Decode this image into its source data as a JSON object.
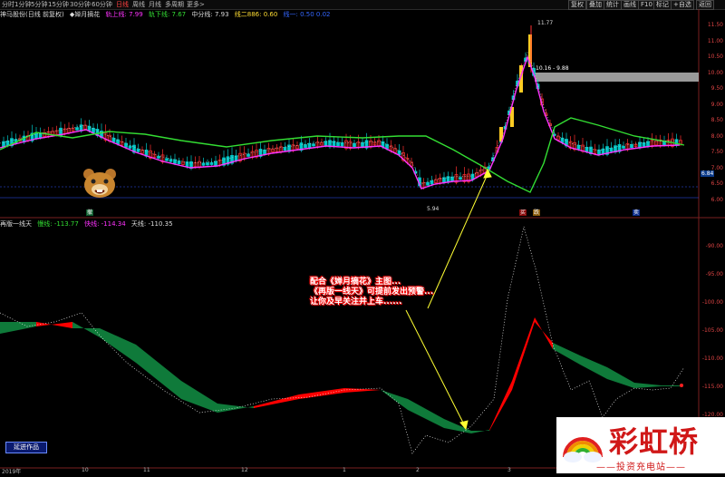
{
  "toolbar": {
    "periods": [
      "分时",
      "1分钟",
      "5分钟",
      "15分钟",
      "30分钟",
      "60分钟",
      "日线",
      "周线",
      "月线",
      "多周期",
      "更多>"
    ],
    "active_period": "日线",
    "right_buttons": [
      "复权",
      "叠加",
      "统计",
      "画线",
      "F10",
      "标记",
      "+自选",
      "返回"
    ]
  },
  "main_panel": {
    "stock": "神马股份(日线 前复权)",
    "indicator": "◆婵月摘花",
    "up_line": "轨上线: 7.99",
    "down_line": "轨下线: 7.67",
    "mid_line": "中分线: 7.93",
    "line2": "线二886: 0.60",
    "line3": "线一: 0.50 0.02",
    "high_label": "11.77",
    "range_label": "10.16 - 9.88",
    "low_label": "5.94",
    "price_tag": "6.84",
    "y_axis": [
      "11.50",
      "11.00",
      "10.50",
      "10.00",
      "9.50",
      "9.00",
      "8.50",
      "8.00",
      "7.50",
      "7.00",
      "6.50",
      "6.00"
    ],
    "markers": [
      "撤",
      "买",
      "跌",
      "卖"
    ]
  },
  "indicator_panel": {
    "name": "再版一线天",
    "line_a": "慢线: -113.77",
    "line_b": "快线: -114.34",
    "line_c": "天线: -110.35",
    "y_axis": [
      "-90.00",
      "-95.00",
      "-100.00",
      "-105.00",
      "-110.00",
      "-115.00",
      "-120.00"
    ]
  },
  "x_axis": [
    "2019年",
    "10",
    "11",
    "12",
    "1",
    "2",
    "3"
  ],
  "annotation": {
    "line1": "配合《婵月摘花》主图...",
    "line2": "《再版一线天》可提前发出预警...",
    "line3": "让你及早关注并上车......"
  },
  "badge": "延迸作品",
  "logo": {
    "title": "彩虹桥",
    "subtitle": "——投资充电站——"
  },
  "colors": {
    "up": "#ff3030",
    "down": "#00c8c8",
    "band_up": "#ff0000",
    "band_down": "#0f7a3a",
    "magenta": "#ff33ff",
    "green": "#33dd33"
  }
}
